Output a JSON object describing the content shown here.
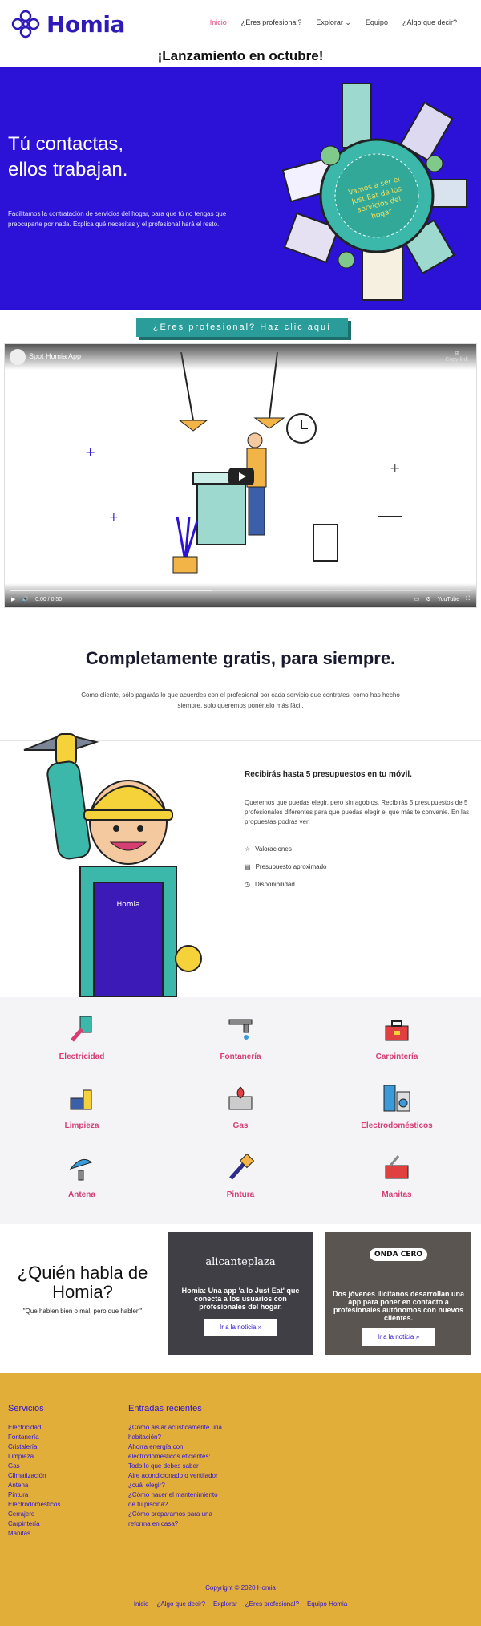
{
  "header": {
    "logo_text": "Homia",
    "nav": [
      "Inicio",
      "¿Eres profesional?",
      "Explorar",
      "Equipo",
      "¿Algo que decir?"
    ]
  },
  "launch": "¡Lanzamiento en octubre!",
  "hero": {
    "title_line1": "Tú contactas,",
    "title_line2": "ellos trabajan.",
    "text": "Facilitamos la contratación de servicios del hogar, para que tú no tengas que preocuparte por nada. Explica qué necesitas y el profesional hará el resto.",
    "badge_text": "Vamos a ser el Just Eat de los servicios del hogar"
  },
  "pro_button": "¿Eres profesional? Haz clic aquí",
  "video": {
    "title": "Spot Homia App",
    "copy_label": "Copy link",
    "time": "0:00 / 0:50",
    "brand": "YouTube",
    "progress": 0.44
  },
  "free": {
    "title": "Completamente gratis, para siempre.",
    "text": "Como cliente, sólo pagarás lo que acuerdes con el profesional por cada servicio que contrates, como has hecho siempre, solo queremos ponértelo más fácil."
  },
  "budget": {
    "title": "Recibirás hasta 5 presupuestos en tu móvil.",
    "text": "Queremos que puedas elegir, pero sin agobios. Recibirás 5 presupuestos de 5 profesionales diferentes para que puedas elegir el que más te convenie. En las propuestas podrás ver:",
    "features": [
      "Valoraciones",
      "Presupuesto aproximado",
      "Disponibilidad"
    ]
  },
  "services": [
    {
      "label": "Electricidad",
      "icon": "electricity-icon"
    },
    {
      "label": "Fontanería",
      "icon": "plumbing-icon"
    },
    {
      "label": "Carpintería",
      "icon": "carpentry-icon"
    },
    {
      "label": "Limpieza",
      "icon": "cleaning-icon"
    },
    {
      "label": "Gas",
      "icon": "gas-icon"
    },
    {
      "label": "Electrodomésticos",
      "icon": "appliances-icon"
    },
    {
      "label": "Antena",
      "icon": "antenna-icon"
    },
    {
      "label": "Pintura",
      "icon": "painting-icon"
    },
    {
      "label": "Manitas",
      "icon": "handyman-icon"
    }
  ],
  "who": {
    "title": "¿Quién habla de Homia?",
    "subtitle": "\"Que hablen bien o mal, pero que hablen\""
  },
  "news": [
    {
      "source": "alicanteplaza",
      "title": "Homia: Una app 'a lo Just Eat' que conecta a los usuarios con profesionales del hogar.",
      "button": "Ir a la noticia »"
    },
    {
      "source": "ONDA CERO",
      "title": "Dos jóvenes ilicitanos desarrollan una app para poner en contacto a profesionales autónomos con nuevos clientes.",
      "button": "Ir a la noticia »"
    }
  ],
  "footer": {
    "services_title": "Servicios",
    "services": [
      "Electricidad",
      "Fontanería",
      "Cristalería",
      "Limpieza",
      "Gas",
      "Climatización",
      "Antena",
      "Pintura",
      "Electrodomésticos",
      "Cerrajero",
      "Carpintería",
      "Manitas"
    ],
    "recent_title": "Entradas recientes",
    "recent": [
      "¿Cómo aislar acústicamente una",
      "habitación?",
      "Ahorra energía con",
      "electrodomésticos eficientes:",
      "Todo lo que debes saber",
      "Aire acondicionado o ventilador",
      "¿cuál elegir?",
      "¿Cómo hacer el mantenimiento",
      "de tu piscina?",
      "¿Cómo preparamos para una",
      "reforma en casa?"
    ],
    "copyright": "Copyright © 2020 Homia",
    "nav": [
      "Inicio",
      "¿Algo que decir?",
      "Explorar",
      "¿Eres profesional?",
      "Equipo Homia"
    ]
  },
  "colors": {
    "brand": "#2b12d6",
    "accent": "#e6457a",
    "teal": "#2a9d9a",
    "footer": "#e2ae3a"
  }
}
